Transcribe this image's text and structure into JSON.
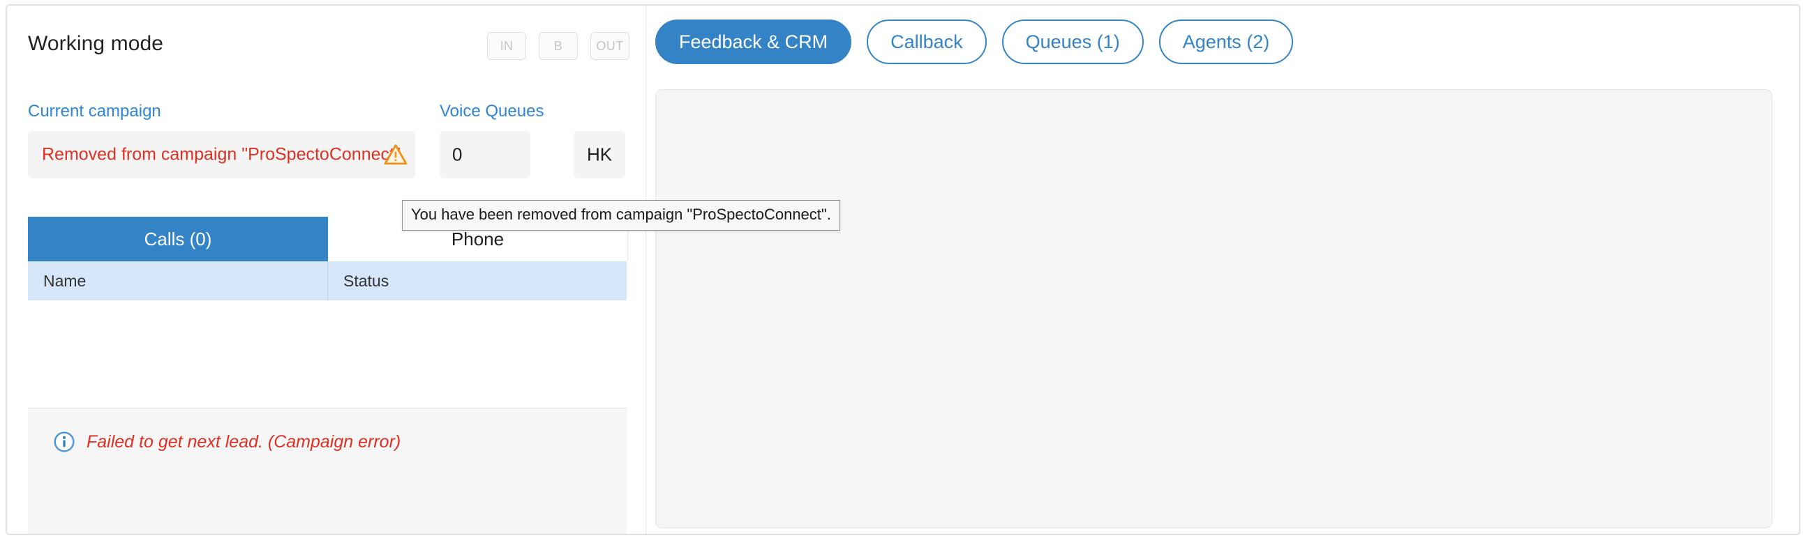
{
  "working_mode": {
    "title": "Working mode",
    "buttons": [
      {
        "label": "IN",
        "name": "mode-in"
      },
      {
        "label": "B",
        "name": "mode-b"
      },
      {
        "label": "OUT",
        "name": "mode-out"
      }
    ]
  },
  "fields": {
    "campaign_label": "Current campaign",
    "campaign_value": "Removed from campaign \"ProSpectoConnect\".",
    "queues_label": "Voice Queues",
    "queues_value": "0",
    "hk_value": "HK",
    "warning_icon": "warning-triangle-icon"
  },
  "tooltip": {
    "text": "You have been removed from campaign \"ProSpectoConnect\"."
  },
  "calls_panel": {
    "tabs": [
      {
        "label": "Calls (0)",
        "active": true
      },
      {
        "label": "Phone",
        "active": false
      }
    ],
    "columns": [
      "Name",
      "Status"
    ],
    "rows": [],
    "footer": {
      "icon": "info-circle-icon",
      "message": "Failed to get next lead. (Campaign error)"
    }
  },
  "right_panel": {
    "tabs": [
      {
        "label": "Feedback & CRM",
        "active": true
      },
      {
        "label": "Callback",
        "active": false
      },
      {
        "label": "Queues (1)",
        "active": false
      },
      {
        "label": "Agents (2)",
        "active": false
      }
    ],
    "content": ""
  },
  "colors": {
    "accent_blue": "#3383c6",
    "link_blue": "#2f86d6",
    "error_red": "#e03024",
    "warning_orange": "#f0921e",
    "table_header_blue": "#d7e7fa",
    "field_gray": "#f4f4f4"
  }
}
